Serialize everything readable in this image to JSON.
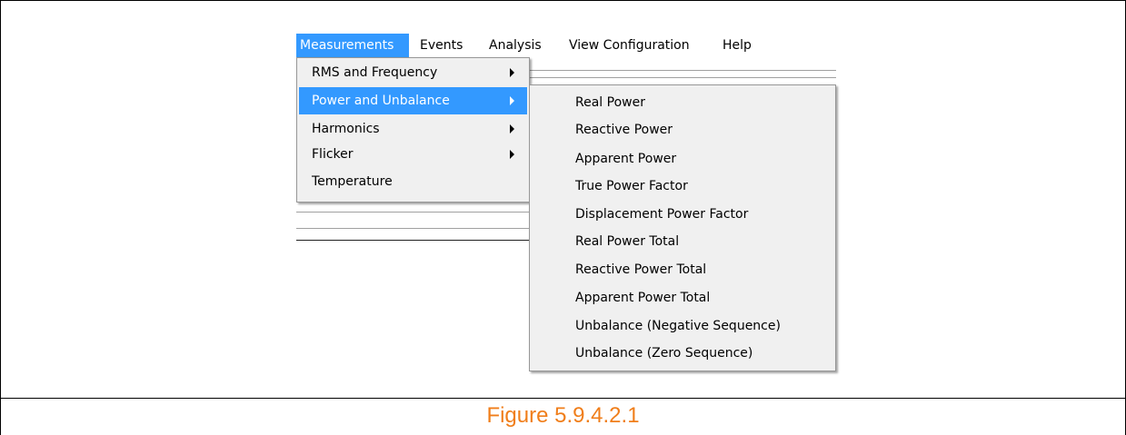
{
  "menubar": {
    "items": [
      "Measurements",
      "Events",
      "Analysis",
      "View Configuration",
      "Help"
    ]
  },
  "measurements_menu": {
    "items": [
      {
        "label": "RMS and Frequency",
        "has_submenu": true
      },
      {
        "label": "Power and Unbalance",
        "has_submenu": true,
        "highlighted": true
      },
      {
        "label": "Harmonics",
        "has_submenu": true
      },
      {
        "label": "Flicker",
        "has_submenu": true
      },
      {
        "label": "Temperature",
        "has_submenu": false
      }
    ]
  },
  "power_submenu": {
    "items": [
      "Real Power",
      "Reactive Power",
      "Apparent Power",
      "True Power Factor",
      "Displacement Power Factor",
      "Real Power Total",
      "Reactive Power Total",
      "Apparent Power Total",
      "Unbalance (Negative Sequence)",
      "Unbalance (Zero Sequence)"
    ]
  },
  "caption": "Figure 5.9.4.2.1",
  "colors": {
    "highlight": "#3399ff",
    "menu_background": "#f0f0f0",
    "caption": "#f07e1a"
  }
}
